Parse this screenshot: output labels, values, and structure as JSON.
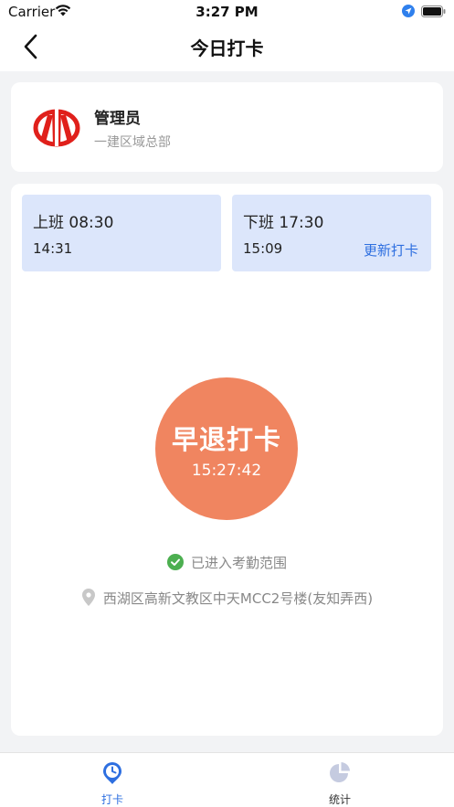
{
  "status_bar": {
    "carrier": "Carrier",
    "time": "3:27 PM"
  },
  "nav": {
    "title": "今日打卡"
  },
  "profile": {
    "name": "管理员",
    "department": "一建区域总部"
  },
  "shifts": {
    "start": {
      "label": "上班 08:30",
      "punched": "14:31"
    },
    "end": {
      "label": "下班 17:30",
      "punched": "15:09",
      "update_label": "更新打卡"
    }
  },
  "punch": {
    "label": "早退打卡",
    "time": "15:27:42"
  },
  "range_status": "已进入考勤范围",
  "address": "西湖区高新文教区中天MCC2号楼(友知弄西)",
  "tabs": [
    {
      "label": "打卡",
      "icon": "clock-pin-icon",
      "active": true
    },
    {
      "label": "统计",
      "icon": "pie-chart-icon",
      "active": false
    }
  ],
  "colors": {
    "accent": "#2e6fe0",
    "punch_button": "#f08560",
    "shift_box": "#dce6fb",
    "success": "#4caf50",
    "logo_red": "#e0201b"
  }
}
